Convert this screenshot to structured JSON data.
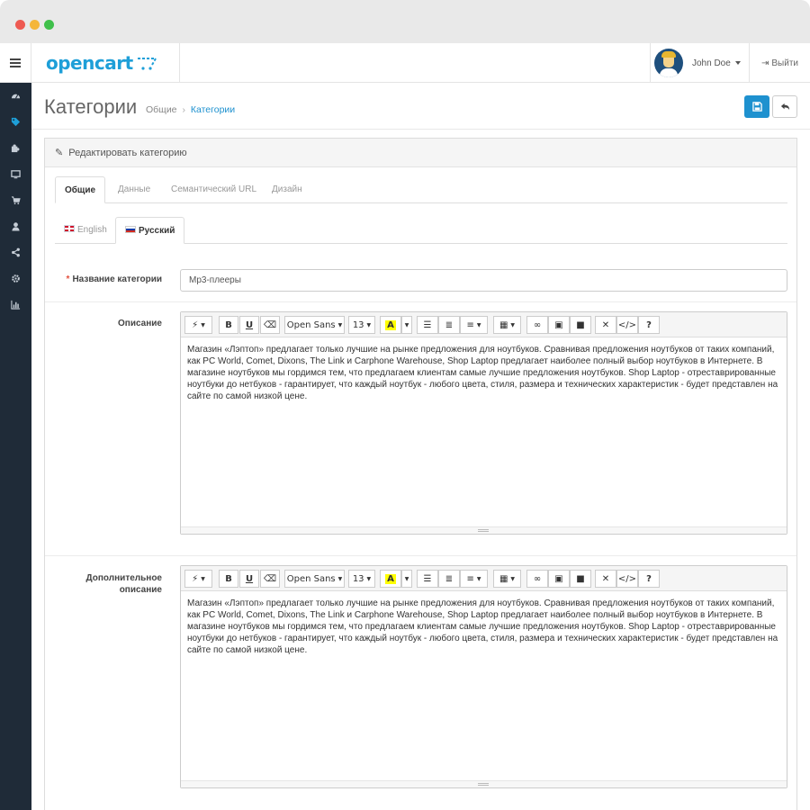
{
  "header": {
    "logo": "opencart",
    "user_name": "John Doe",
    "logout_label": "Выйти"
  },
  "page": {
    "title": "Категории",
    "breadcrumb": [
      "Общие",
      "Категории"
    ],
    "breadcrumb_separator": "›"
  },
  "panel": {
    "heading": "Редактировать категорию"
  },
  "tabs": [
    "Общие",
    "Данные",
    "Семантический URL",
    "Дизайн"
  ],
  "language_tabs": [
    "English",
    "Русский"
  ],
  "form": {
    "name_label": "Название категории",
    "name_value": "Mp3-плееры",
    "description_label": "Описание",
    "additional_label_line1": "Дополнительное",
    "additional_label_line2": "описание",
    "description_text": "Магазин «Лэптоп» предлагает только лучшие на рынке предложения для ноутбуков. Сравнивая предложения ноутбуков от таких компаний, как PC World, Comet, Dixons, The Link и Carphone Warehouse, Shop Laptop предлагает наиболее полный выбор ноутбуков в Интернете. В магазине ноутбуков мы гордимся тем, что предлагаем клиентам самые лучшие предложения ноутбуков. Shop Laptop - отреставрированные ноутбуки до нетбуков - гарантирует, что каждый ноутбук - любого цвета, стиля, размера и технических характеристик - будет представлен на сайте по самой низкой цене.",
    "additional_text": "Магазин «Лэптоп» предлагает только лучшие на рынке предложения для ноутбуков. Сравнивая предложения ноутбуков от таких компаний, как PC World, Comet, Dixons, The Link и Carphone Warehouse, Shop Laptop предлагает наиболее полный выбор ноутбуков в Интернете. В магазине ноутбуков мы гордимся тем, что предлагаем клиентам самые лучшие предложения ноутбуков. Shop Laptop - отреставрированные ноутбуки до нетбуков - гарантирует, что каждый ноутбук - любого цвета, стиля, размера и технических характеристик - будет представлен на сайте по самой низкой цене."
  },
  "toolbar": {
    "bold": "B",
    "underline": "U",
    "font": "Open Sans",
    "size": "13",
    "highlight": "A",
    "code": "</>",
    "help": "?"
  },
  "sidebar": {
    "icons": [
      "dashboard-icon",
      "tag-icon",
      "puzzle-icon",
      "desktop-icon",
      "cart-icon",
      "user-icon",
      "share-icon",
      "gear-icon",
      "bar-chart-icon"
    ]
  },
  "colors": {
    "brand": "#1e9fd8",
    "sidebar_bg": "#1f2b38",
    "primary_button": "#1e91cf",
    "required": "#e3503e"
  }
}
